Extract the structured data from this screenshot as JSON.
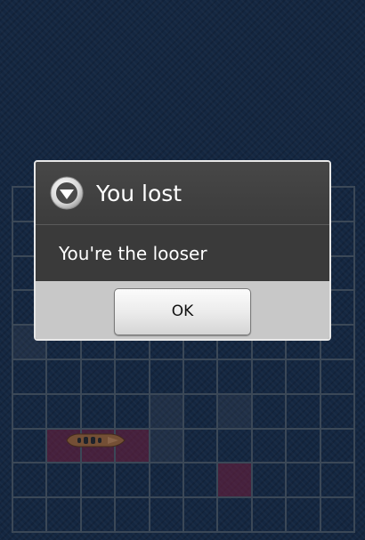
{
  "game": {
    "grid_columns": 10,
    "grid_rows": 10,
    "miss_cells": [
      [
        0,
        4
      ],
      [
        4,
        6
      ],
      [
        4,
        7
      ],
      [
        6,
        6
      ]
    ],
    "hit_cells": [
      [
        1,
        7
      ],
      [
        2,
        7
      ],
      [
        3,
        7
      ],
      [
        6,
        8
      ]
    ],
    "ship_icon": "ship-icon"
  },
  "dialog": {
    "icon": "warning-arrow-icon",
    "title": "You lost",
    "message": "You're the looser",
    "ok_label": "OK"
  },
  "colors": {
    "background": "#1b3457",
    "grid_line": "#4f6074",
    "hit": "#962850",
    "dialog_footer": "#c8c8c8"
  }
}
